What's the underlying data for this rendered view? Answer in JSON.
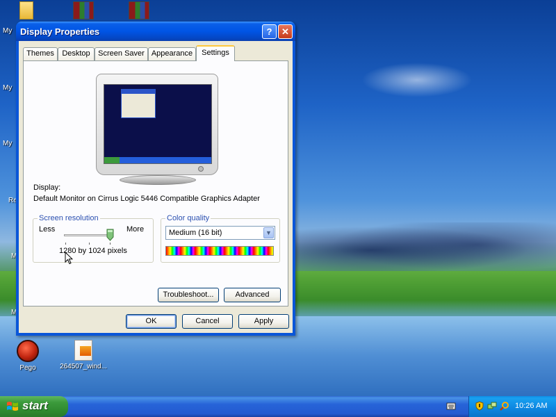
{
  "desktop": {
    "left_labels": [
      "My",
      "My",
      "My",
      "Re",
      "M",
      "M"
    ],
    "icons": [
      {
        "label": "Pego",
        "icon": "pego-icon"
      },
      {
        "label": "264507_wind...",
        "icon": "file-icon"
      }
    ]
  },
  "window": {
    "title": "Display Properties",
    "help_glyph": "?",
    "close_glyph": "✕",
    "tabs": [
      {
        "label": "Themes",
        "active": false
      },
      {
        "label": "Desktop",
        "active": false
      },
      {
        "label": "Screen Saver",
        "active": false
      },
      {
        "label": "Appearance",
        "active": false
      },
      {
        "label": "Settings",
        "active": true
      }
    ],
    "display_label": "Display:",
    "display_value": "Default Monitor on Cirrus Logic 5446 Compatible Graphics Adapter",
    "resolution": {
      "legend": "Screen resolution",
      "less": "Less",
      "more": "More",
      "value_text": "1280 by 1024 pixels",
      "slider_level": 1.0
    },
    "color_quality": {
      "legend": "Color quality",
      "selected": "Medium (16 bit)",
      "arrow": "▼"
    },
    "buttons": {
      "troubleshoot": "Troubleshoot...",
      "advanced": "Advanced",
      "ok": "OK",
      "cancel": "Cancel",
      "apply": "Apply"
    }
  },
  "taskbar": {
    "start_label": "start",
    "clock": "10:26 AM"
  },
  "colors": {
    "title_blue": "#0055e5",
    "tab_highlight": "#ffc83c",
    "group_legend": "#2a4fb0",
    "start_green": "#3c9a3c"
  }
}
